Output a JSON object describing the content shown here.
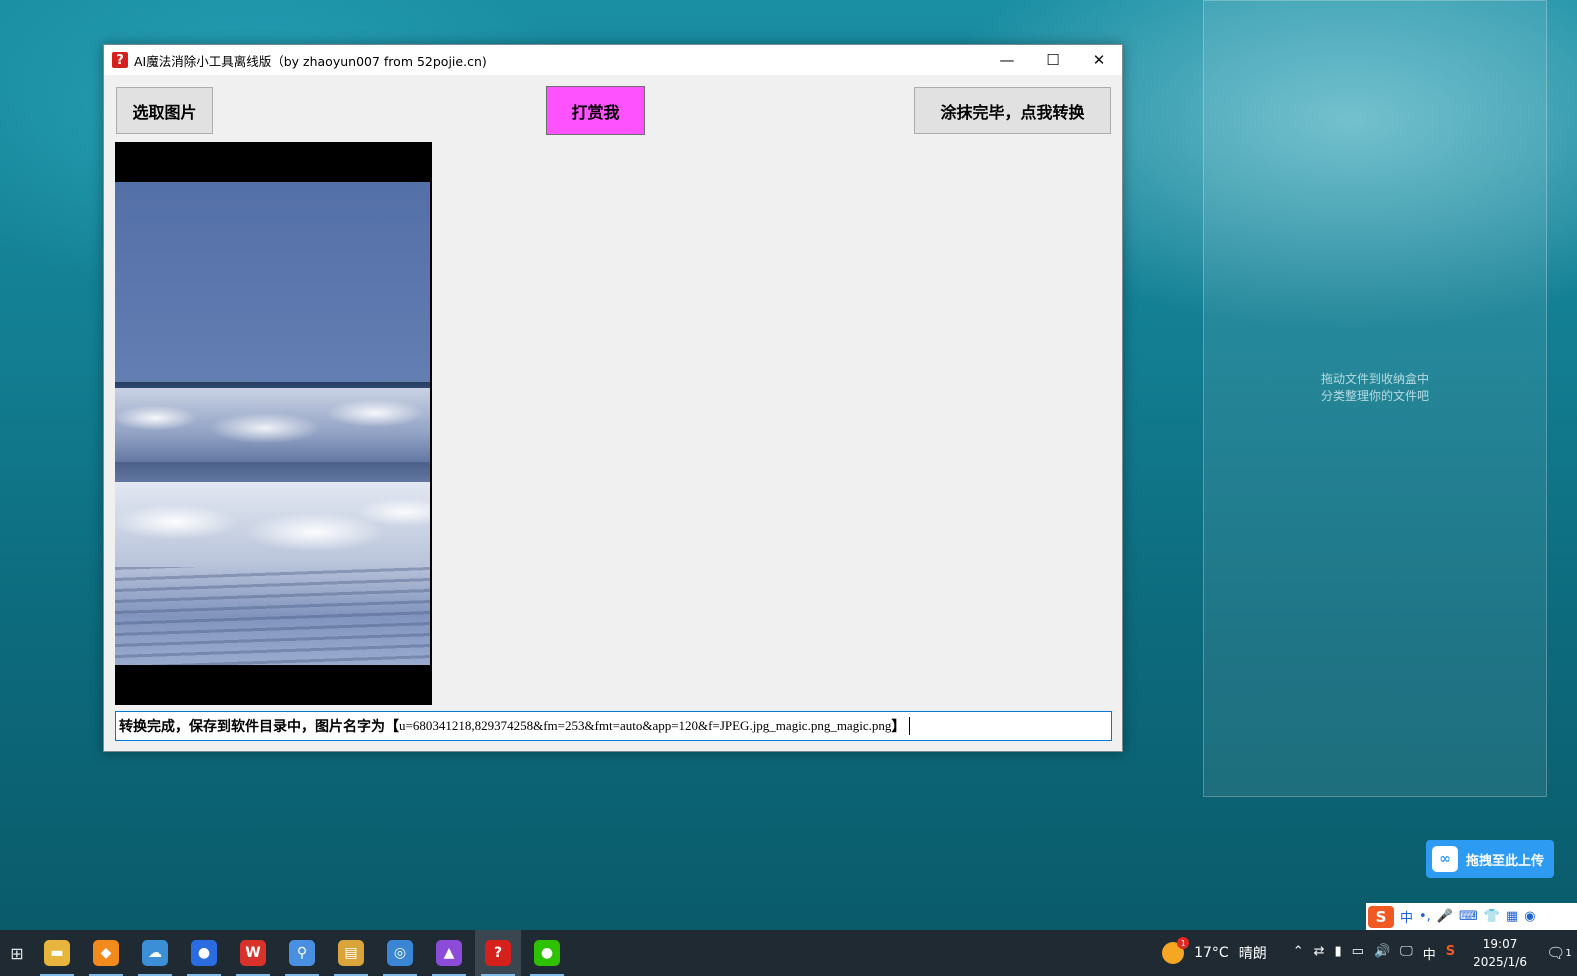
{
  "desktop": {
    "fence_hint_line1": "拖动文件到收纳盒中",
    "fence_hint_line2": "分类整理你的文件吧",
    "upload_label": "拖拽至此上传"
  },
  "window": {
    "title": "AI魔法消除小工具离线版（by zhaoyun007 from 52pojie.cn)",
    "controls": {
      "minimize": "—",
      "maximize": "☐",
      "close": "✕"
    }
  },
  "toolbar": {
    "select_label": "选取图片",
    "donate_label": "打赏我",
    "convert_label": "涂抹完毕，点我转换"
  },
  "status": {
    "message": "转换完成，保存到软件目录中，图片名字为【",
    "filename": "u=680341218,829374258&fm=253&fmt=auto&app=120&f=JPEG.jpg_magic.png_magic.png",
    "suffix": "】"
  },
  "colors": {
    "donate_bg": "#ff52ff",
    "focus_border": "#0078d7",
    "taskbar_bg": "#1f2a33"
  },
  "ime": {
    "mode": "中",
    "punct": "•,"
  },
  "taskbar": {
    "apps": [
      {
        "name": "file-explorer-icon",
        "color": "#e8b53c",
        "glyph": "▬"
      },
      {
        "name": "app-orange-icon",
        "color": "#f28a1e",
        "glyph": "◆"
      },
      {
        "name": "app-blue-cloud-icon",
        "color": "#3b8fd6",
        "glyph": "☁"
      },
      {
        "name": "browser-icon",
        "color": "#2b6de0",
        "glyph": "●"
      },
      {
        "name": "wps-icon",
        "color": "#d9322a",
        "glyph": "W"
      },
      {
        "name": "pinned-app-icon",
        "color": "#4a90e2",
        "glyph": "⚲"
      },
      {
        "name": "archive-icon",
        "color": "#d9a43a",
        "glyph": "▤"
      },
      {
        "name": "globe-app-icon",
        "color": "#3a86d4",
        "glyph": "◎"
      },
      {
        "name": "editor-app-icon",
        "color": "#8c4bd8",
        "glyph": "▲"
      },
      {
        "name": "magic-eraser-app-icon",
        "color": "#d6201b",
        "glyph": "?",
        "active": true
      },
      {
        "name": "wechat-icon",
        "color": "#2dc100",
        "glyph": "●"
      }
    ],
    "weather_temp": "17°C",
    "weather_desc": "晴朗",
    "weather_badge": "1",
    "tray_lang": "中",
    "time": "19:07",
    "date": "2025/1/6",
    "notif_count": "1"
  }
}
